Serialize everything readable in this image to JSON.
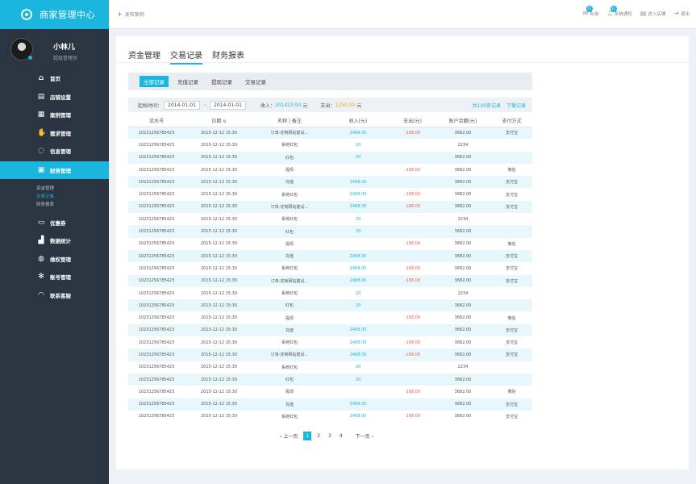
{
  "app": {
    "title": "商家管理中心"
  },
  "profile": {
    "name": "小林儿",
    "role": "超级管理员"
  },
  "sidebar": {
    "items": [
      {
        "label": "首页",
        "icon": "home-icon"
      },
      {
        "label": "店铺设置",
        "icon": "store-icon"
      },
      {
        "label": "案例管理",
        "icon": "grid-icon"
      },
      {
        "label": "需求管理",
        "icon": "hand-icon"
      },
      {
        "label": "信息管理",
        "icon": "chat-icon"
      },
      {
        "label": "财务管理",
        "icon": "wallet-icon",
        "active": true
      },
      {
        "label": "优惠券",
        "icon": "coupon-icon"
      },
      {
        "label": "数据统计",
        "icon": "chart-icon"
      },
      {
        "label": "维权管理",
        "icon": "shield-icon"
      },
      {
        "label": "账号管理",
        "icon": "gear-icon"
      },
      {
        "label": "联系客服",
        "icon": "headset-icon"
      }
    ],
    "sub_items": [
      "资金管理",
      "交易记录",
      "财务报表"
    ]
  },
  "topbar": {
    "publish": "发布案例",
    "items": [
      {
        "label": "私信",
        "badge": "11",
        "icon": "mail-icon"
      },
      {
        "label": "系统通知",
        "badge": "11",
        "icon": "bell-icon"
      },
      {
        "label": "进入店铺",
        "icon": "store-icon"
      },
      {
        "label": "退出",
        "icon": "logout-icon"
      }
    ]
  },
  "tabs": [
    "资金管理",
    "交易记录",
    "财务报表"
  ],
  "subtabs": [
    "全部记录",
    "充值记录",
    "提现记录",
    "交易记录"
  ],
  "filter": {
    "start_label": "起始时间：",
    "start_date": "2014-01-01",
    "dash": "-",
    "end_date": "2014-01-01",
    "income_label": "收入：",
    "income_value": "201423.00",
    "income_unit": "元",
    "expense_label": "支出：",
    "expense_value": "1250.00",
    "expense_unit": "元",
    "total": "共100条记录",
    "download": "下载记录"
  },
  "table": {
    "headers": [
      "流水号",
      "日期",
      "名称 | 备注",
      "收入(元)",
      "支出(元)",
      "账户余额(元)",
      "支付方式"
    ],
    "rows": [
      [
        "10231256785423",
        "2015-12-12 15:30",
        "订单-定制网站建设...",
        "2468.00",
        "-168.00",
        "3682.00",
        "支付宝"
      ],
      [
        "10231256785423",
        "2015-12-12 15:30",
        "系统红包",
        "20",
        "",
        "2234",
        ""
      ],
      [
        "10231256785423",
        "2015-12-12 15:30",
        "红包",
        "20",
        "",
        "3682.00",
        ""
      ],
      [
        "10231256785423",
        "2015-12-12 15:30",
        "提现",
        "",
        "-168.00",
        "3682.00",
        "微信"
      ],
      [
        "10231256785423",
        "2015-12-12 15:30",
        "充值",
        "2468.00",
        "",
        "3682.00",
        "支付宝"
      ],
      [
        "10231256785423",
        "2015-12-12 15:30",
        "系统红包",
        "2468.00",
        "-168.00",
        "3682.00",
        "支付宝"
      ],
      [
        "10231256785423",
        "2015-12-12 15:30",
        "订单-定制网站建设...",
        "2468.00",
        "-168.00",
        "3682.00",
        "支付宝"
      ],
      [
        "10231256785423",
        "2015-12-12 15:30",
        "系统红包",
        "20",
        "",
        "2234",
        ""
      ],
      [
        "10231256785423",
        "2015-12-12 15:30",
        "红包",
        "20",
        "",
        "3682.00",
        ""
      ],
      [
        "10231256785423",
        "2015-12-12 15:30",
        "提现",
        "",
        "-168.00",
        "3682.00",
        "微信"
      ],
      [
        "10231256785423",
        "2015-12-12 15:30",
        "充值",
        "2468.00",
        "",
        "3682.00",
        "支付宝"
      ],
      [
        "10231256785423",
        "2015-12-12 15:30",
        "系统红包",
        "2468.00",
        "-168.00",
        "3682.00",
        "支付宝"
      ],
      [
        "10231256785423",
        "2015-12-12 15:30",
        "订单-定制网站建设...",
        "2468.00",
        "-168.00",
        "3682.00",
        "支付宝"
      ],
      [
        "10231256785423",
        "2015-12-12 15:30",
        "系统红包",
        "20",
        "",
        "2234",
        ""
      ],
      [
        "10231256785423",
        "2015-12-12 15:30",
        "红包",
        "20",
        "",
        "3682.00",
        ""
      ],
      [
        "10231256785423",
        "2015-12-12 15:30",
        "提现",
        "",
        "-168.00",
        "3682.00",
        "微信"
      ],
      [
        "10231256785423",
        "2015-12-12 15:30",
        "充值",
        "2468.00",
        "",
        "3682.00",
        "支付宝"
      ],
      [
        "10231256785423",
        "2015-12-12 15:30",
        "系统红包",
        "2468.00",
        "-168.00",
        "3682.00",
        "支付宝"
      ],
      [
        "10231256785423",
        "2015-12-12 15:30",
        "订单-定制网站建设...",
        "2468.00",
        "-168.00",
        "3682.00",
        "支付宝"
      ],
      [
        "10231256785423",
        "2015-12-12 15:30",
        "系统红包",
        "20",
        "",
        "2234",
        ""
      ],
      [
        "10231256785423",
        "2015-12-12 15:30",
        "红包",
        "20",
        "",
        "3682.00",
        ""
      ],
      [
        "10231256785423",
        "2015-12-12 15:30",
        "提现",
        "",
        "-168.00",
        "3682.00",
        "微信"
      ],
      [
        "10231256785423",
        "2015-12-12 15:30",
        "充值",
        "2468.00",
        "",
        "3682.00",
        "支付宝"
      ],
      [
        "10231256785423",
        "2015-12-12 15:30",
        "系统红包",
        "2468.00",
        "-168.00",
        "3682.00",
        "支付宝"
      ]
    ]
  },
  "pager": {
    "prev": "上一页",
    "pages": [
      "1",
      "2",
      "3",
      "4"
    ],
    "next": "下一页"
  },
  "colors": {
    "accent": "#1ab6de",
    "sidebar": "#2b3441",
    "income": "#1ab6de",
    "expense": "#f25a46"
  }
}
